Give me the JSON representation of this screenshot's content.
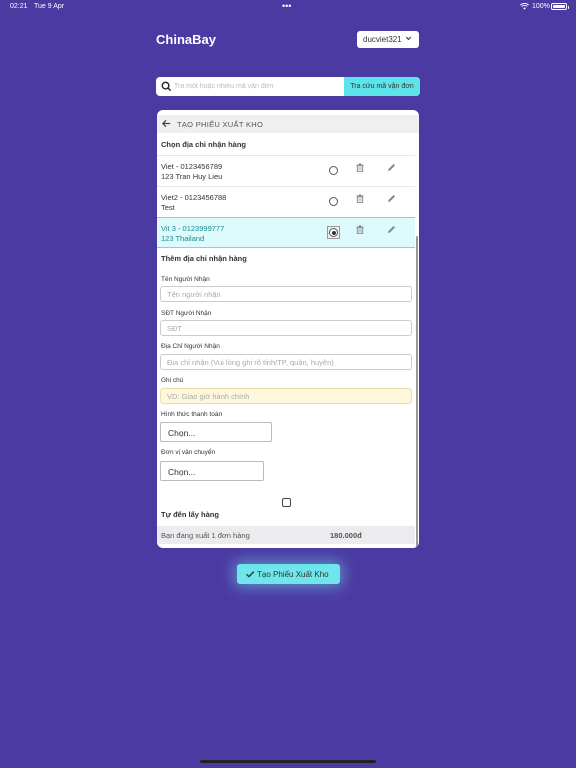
{
  "status_bar": {
    "time": "02:21",
    "date": "Tue 9 Apr",
    "battery": "100%"
  },
  "header": {
    "brand": "ChinaBay",
    "user": "ducviet321"
  },
  "search": {
    "placeholder": "Tra một hoặc nhiều mã vận đơn",
    "button_label": "Tra cứu mã vận đơn"
  },
  "panel": {
    "title": "TẠO PHIẾU XUẤT KHO",
    "choose_address_title": "Chọn địa chỉ nhận hàng",
    "addresses": [
      {
        "line1": "Viet - 0123456789",
        "line2": "123 Tran Huy Lieu",
        "selected": false
      },
      {
        "line1": "Viet2 - 0123456788",
        "line2": "Test",
        "selected": false
      },
      {
        "line1": "Vit 3 - 0123999777",
        "line2": "123 Thailand",
        "selected": true
      }
    ],
    "add_address_title": "Thêm địa chỉ nhận hàng",
    "fields": {
      "receiver_name": {
        "label": "Tên Người Nhận",
        "placeholder": "Tên người nhận"
      },
      "receiver_phone": {
        "label": "SĐT Người Nhận",
        "placeholder": "SĐT"
      },
      "receiver_address": {
        "label": "Địa Chỉ Người Nhận",
        "placeholder": "Địa chỉ nhận (Vui lòng ghi rõ tỉnh/TP, quận, huyện)"
      },
      "note": {
        "label": "Ghi chú",
        "placeholder": "VD: Giao giờ hành chính"
      }
    },
    "payment": {
      "label": "Hình thức thanh toán",
      "value": "Chọn..."
    },
    "shipping": {
      "label": "Đơn vị vận chuyển",
      "value": "Chọn..."
    },
    "self_pickup_label": "Tự đến lấy hàng",
    "summary": {
      "text": "Bạn đang xuất 1 đơn hàng",
      "amount": "180.000đ"
    }
  },
  "submit_label": "Tạo Phiếu Xuất Kho",
  "colors": {
    "background": "#4c3aa3",
    "accent": "#5de4ea"
  }
}
